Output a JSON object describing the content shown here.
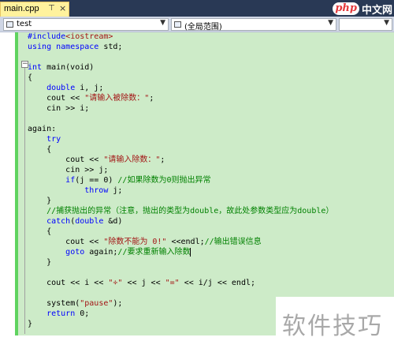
{
  "tabs": [
    {
      "label": "main.cpp",
      "pin": "⊤",
      "close": "×"
    }
  ],
  "logo": {
    "php": "php",
    "cn": "中文网"
  },
  "nav": {
    "scope_left": "test",
    "scope_right": "(全局范围)"
  },
  "code": {
    "l1_pp": "#include",
    "l1_rest": "<iostream>",
    "l2_kw1": "using",
    "l2_kw2": "namespace",
    "l2_rest": " std;",
    "l4_kw": "int",
    "l4_rest": " main(void)",
    "l5": "{",
    "l6_kw": "double",
    "l6_rest": " i, j;",
    "l7_a": "cout << ",
    "l7_str": "\"请输入被除数：\"",
    "l7_b": ";",
    "l8": "cin >> i;",
    "l10": "again:",
    "l11_kw": "try",
    "l12": "{",
    "l13_a": "cout << ",
    "l13_str": "\"请输入除数：\"",
    "l13_b": ";",
    "l14": "cin >> j;",
    "l15_kw": "if",
    "l15_a": "(j == 0) ",
    "l15_cmt": "//如果除数为0则抛出异常",
    "l16_kw": "throw",
    "l16_rest": " j;",
    "l17": "}",
    "l18_cmt": "//捕获抛出的异常（注意，抛出的类型为double，故此处参数类型应为double）",
    "l19_kw1": "catch",
    "l19_a": "(",
    "l19_kw2": "double",
    "l19_b": " &d)",
    "l20": "{",
    "l21_a": "cout << ",
    "l21_str": "\"除数不能为 0!\"",
    "l21_b": " <<endl;",
    "l21_cmt": "//输出错误信息",
    "l22_kw": "goto",
    "l22_a": " again;",
    "l22_cmt": "//要求重新输入除数",
    "l23": "}",
    "l25_a": "cout << i << ",
    "l25_s1": "\"÷\"",
    "l25_b": " << j << ",
    "l25_s2": "\"=\"",
    "l25_c": " << i/j << endl;",
    "l27_a": "system(",
    "l27_str": "\"pause\"",
    "l27_b": ");",
    "l28_kw": "return",
    "l28_rest": " 0;",
    "l29": "}"
  },
  "watermark": "软件技巧"
}
